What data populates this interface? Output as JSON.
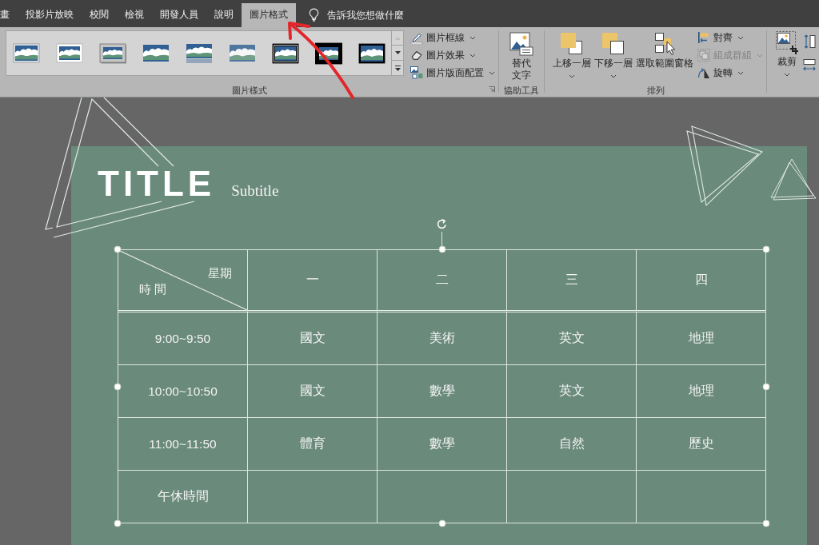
{
  "tabs": [
    {
      "label": "畫",
      "selected": false
    },
    {
      "label": "投影片放映",
      "selected": false
    },
    {
      "label": "校閱",
      "selected": false
    },
    {
      "label": "檢視",
      "selected": false
    },
    {
      "label": "開發人員",
      "selected": false
    },
    {
      "label": "說明",
      "selected": false
    },
    {
      "label": "圖片格式",
      "selected": true
    }
  ],
  "tell_me": {
    "placeholder": "告訴我您想做什麼"
  },
  "ribbon": {
    "picture_styles": {
      "label": "圖片樣式",
      "commands": [
        {
          "kind": "border",
          "label": "圖片框線",
          "disabled": false
        },
        {
          "kind": "effects",
          "label": "圖片效果",
          "disabled": false
        },
        {
          "kind": "layout",
          "label": "圖片版面配置",
          "disabled": false
        }
      ]
    },
    "accessibility": {
      "label": "協助工具",
      "buttons": [
        {
          "kind": "alt_text",
          "label": "替代文字",
          "dropdown": false
        }
      ]
    },
    "arrange": {
      "label": "排列",
      "buttons": [
        {
          "kind": "bring_forward",
          "label": "上移一層",
          "dropdown": true
        },
        {
          "kind": "send_backward",
          "label": "下移一層",
          "dropdown": true
        },
        {
          "kind": "selection_pane",
          "label": "選取範圍窗格",
          "dropdown": false
        }
      ],
      "commands": [
        {
          "kind": "align",
          "label": "對齊",
          "disabled": false
        },
        {
          "kind": "group",
          "label": "組成群組",
          "disabled": true
        },
        {
          "kind": "rotate",
          "label": "旋轉",
          "disabled": false
        }
      ]
    },
    "size": {
      "buttons": [
        {
          "kind": "crop",
          "label": "裁剪",
          "dropdown": true
        }
      ]
    }
  },
  "slide": {
    "title": "TITLE",
    "subtitle": "Subtitle",
    "table": {
      "corner": {
        "top": "星期",
        "bottom": "時 間"
      },
      "columns": [
        "一",
        "二",
        "三",
        "四"
      ],
      "rows": [
        {
          "time": "9:00~9:50",
          "cells": [
            "國文",
            "美術",
            "英文",
            "地理"
          ]
        },
        {
          "time": "10:00~10:50",
          "cells": [
            "國文",
            "數學",
            "英文",
            "地理"
          ]
        },
        {
          "time": "11:00~11:50",
          "cells": [
            "體育",
            "數學",
            "自然",
            "歷史"
          ]
        },
        {
          "time": "午休時間"
        }
      ]
    }
  }
}
